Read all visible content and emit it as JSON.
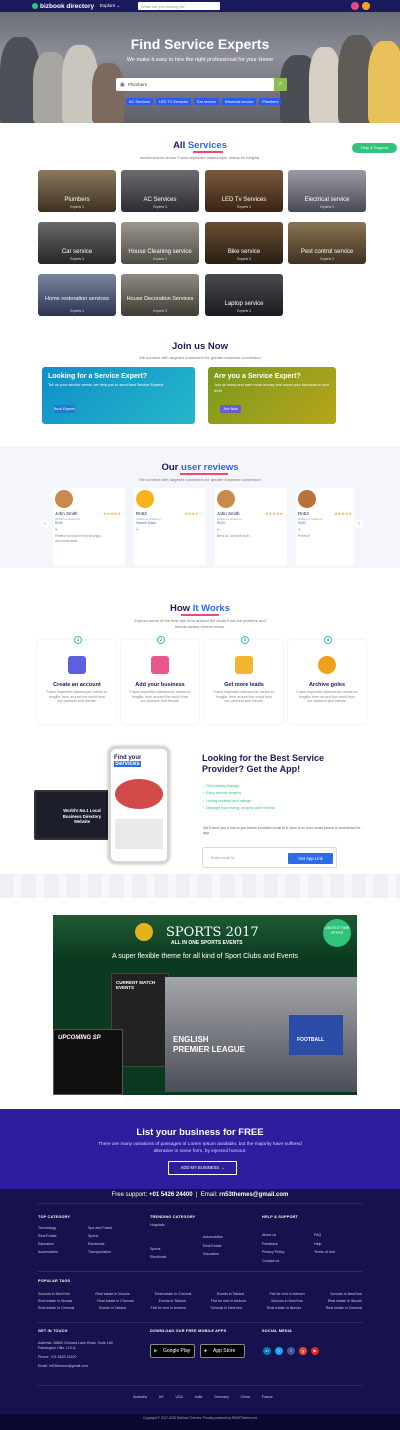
{
  "header": {
    "logo": "bizbook directory",
    "explore": "Explore ⌄",
    "search_placeholder": "What are you looking for?"
  },
  "hero": {
    "title": "Find Service Experts",
    "subtitle": "We make it easy to hire the right professional for your Home",
    "search_value": "Plumbers",
    "chips": [
      "AC Services",
      "LED TV Services",
      "Car service",
      "Electrical service",
      "Plumbers"
    ]
  },
  "help_button": "Help & Support",
  "all_services": {
    "title_a": "All",
    "title_b": "Services",
    "subtitle": "Iacinia viverra lectus Fusce imperdiet ullamcorper metus eu fringilla.",
    "cards": [
      {
        "label": "Plumbers",
        "count": "Experts 3"
      },
      {
        "label": "AC Services",
        "count": "Experts 3"
      },
      {
        "label": "LED Tv Services",
        "count": "Experts 3"
      },
      {
        "label": "Electrical service",
        "count": "Experts 3"
      },
      {
        "label": "Car service",
        "count": "Experts 3"
      },
      {
        "label": "House Cleaning service",
        "count": "Experts 3"
      },
      {
        "label": "Bike service",
        "count": "Experts 3"
      },
      {
        "label": "Pest control service",
        "count": "Experts 3"
      },
      {
        "label": "Home restoration services",
        "count": "Experts 3"
      },
      {
        "label": "House Decoration Services",
        "count": "Experts 3"
      },
      {
        "label": "Laptop service",
        "count": "Experts 3"
      }
    ]
  },
  "join": {
    "title": "Join us Now",
    "subtitle": "We connect with targeted customers for greater business conversion",
    "left": {
      "title": "Looking for a Service Expert?",
      "text": "Tell us your service needs, we help you to send best Service Experts",
      "button": "Book Experts"
    },
    "right": {
      "title": "Are you a Service Expert?",
      "text": "Join us today and earn more money and move your business to next level",
      "button": "Join Now"
    }
  },
  "reviews": {
    "title_a": "Our",
    "title_b": "user reviews",
    "subtitle": "We connect with targeted customers for greater business conversion",
    "items": [
      {
        "name": "John Smith",
        "stars": "★★★★★",
        "meta": "Written a review to",
        "target": "Rn53",
        "text": "Perfect service every strongly recommended"
      },
      {
        "name": "Rn53",
        "stars": "★★★★☆",
        "meta": "Written a review to",
        "target": "Samuel Dylan",
        "text": ""
      },
      {
        "name": "John Smith",
        "stars": "★★★★★",
        "meta": "Written a review to",
        "target": "Rn53",
        "text": "Best AC service ever..."
      },
      {
        "name": "Rn53",
        "stars": "★★★★★",
        "meta": "Written a review to",
        "target": "Rn53",
        "text": "Perfect!"
      }
    ]
  },
  "how": {
    "title_a": "How",
    "title_b": "It Works",
    "subtitle": "Explore some of the best tips from around the world from our partners and friends.lacinia viverra lectus.",
    "steps": [
      {
        "num": "1",
        "title": "Create an account",
        "text": "Fusce imperdiet ullamcorper metus eu fringilla. from around the world from our partners and friends."
      },
      {
        "num": "2",
        "title": "Add your business",
        "text": "Fusce imperdiet ullamcorper metus eu fringilla. from around the world from our partners and friends."
      },
      {
        "num": "3",
        "title": "Get more leads",
        "text": "Fusce imperdiet ullamcorper metus eu fringilla. from around the world from our partners and friends."
      },
      {
        "num": "4",
        "title": "Archive goles",
        "text": "Fusce imperdiet ullamcorper metus eu fringilla. from around the world from our partners and friends."
      }
    ]
  },
  "app": {
    "title": "Looking for the Best Service Provider? Get the App!",
    "list": [
      "Find nearby listings",
      "Easy service enquiry",
      "Listing reviews and ratings",
      "Manage your listing, enquiry and reviews"
    ],
    "note": "We'll send you a link to you below provided email id & open it on your smart phone to download the app",
    "email_placeholder": "Enter email id",
    "button": "Get App Link",
    "phone_heading_a": "Find your",
    "phone_heading_b": "Services",
    "laptop_text": "World's No.1 Local Business Directory Website"
  },
  "banner": {
    "title": "SPORTS 2017",
    "subtitle": "ALL IN ONE SPORTS EVENTS",
    "tagline": "A super flexible theme for all kind of Sport Clubs and Events",
    "badge": "LIMITED TIME OFFER",
    "match": "CURRENT MATCH EVENTS",
    "league_a": "ENGLISH",
    "league_b": "PREMIER LEAGUE",
    "upcoming": "UPCOMING SP",
    "football": "FOOTBALL"
  },
  "cta": {
    "title": "List your business for FREE",
    "text": "There are many variations of passages of Lorem Ipsum available, but the majority have suffered alteration in some form, by injected humour.",
    "button": "ADD MY BUSINESS →"
  },
  "footer": {
    "support_label": "Free support:",
    "support_phone": "+01 5426 24400",
    "email_label": "Email:",
    "email": "rn53themes@gmail.com",
    "top_category": {
      "title": "TOP CATEGORY",
      "col1": [
        "Technology",
        "Real Estate",
        "Education",
        "Automobiles"
      ],
      "col2": [
        "Spa and Facial",
        "Sports",
        "Electricals",
        "Transportation"
      ]
    },
    "trending": {
      "title": "TRENDING CATEGORY",
      "col1": [
        "Hospitals",
        "Sports",
        "Electricals"
      ],
      "col2": [
        "Automobiles",
        "Real Estate",
        "Education"
      ]
    },
    "help": {
      "title": "HELP & SUPPORT",
      "col1": [
        "About us",
        "Feedback",
        "Privacy Policy",
        "Contact us"
      ],
      "col2": [
        "FAQ",
        "Help",
        "Terms of Use"
      ]
    },
    "popular": {
      "title": "POPULAR TAGS",
      "rows": [
        [
          "Schools in NewYork",
          "Real estate in Illunois",
          "Real estate in Chennai",
          "Events in Tailand",
          "Flat for rent in leeborn",
          "Schools in NewYork"
        ],
        [
          "Real estate in Illunois",
          "Real estate in Chennai",
          "Events in Tailand",
          "Flat for rent in leeborn",
          "Schools in NewYork",
          "Real estate in Illunois"
        ],
        [
          "Real estate in Chennai",
          "Events in Tailand",
          "Flat for rent in leeborn",
          "Schools in NewYork",
          "Real estate in Illunois",
          "Real estate in Chennai"
        ]
      ]
    },
    "contact": {
      "title": "GET IN TOUCH",
      "address": "Address: 28800 Orchard Lake Road, Suite 180 Farmington Hills, U.S.A.",
      "phone": "Phone: +01 5426 24400",
      "email": "Email: rn53themes@gmail.com"
    },
    "apps": {
      "title": "DOWNLOAD OUR FREE MOBILE APPS",
      "google": "Google Play",
      "apple": "App Store"
    },
    "social": {
      "title": "SOCIAL MEDIA"
    },
    "countries": [
      "Australia",
      "UK",
      "USA",
      "India",
      "Germany",
      "China",
      "France"
    ],
    "copyright": "Copyright © 2017-2020 BizBook Themes. Proudly powered by RN53Themes.net"
  }
}
